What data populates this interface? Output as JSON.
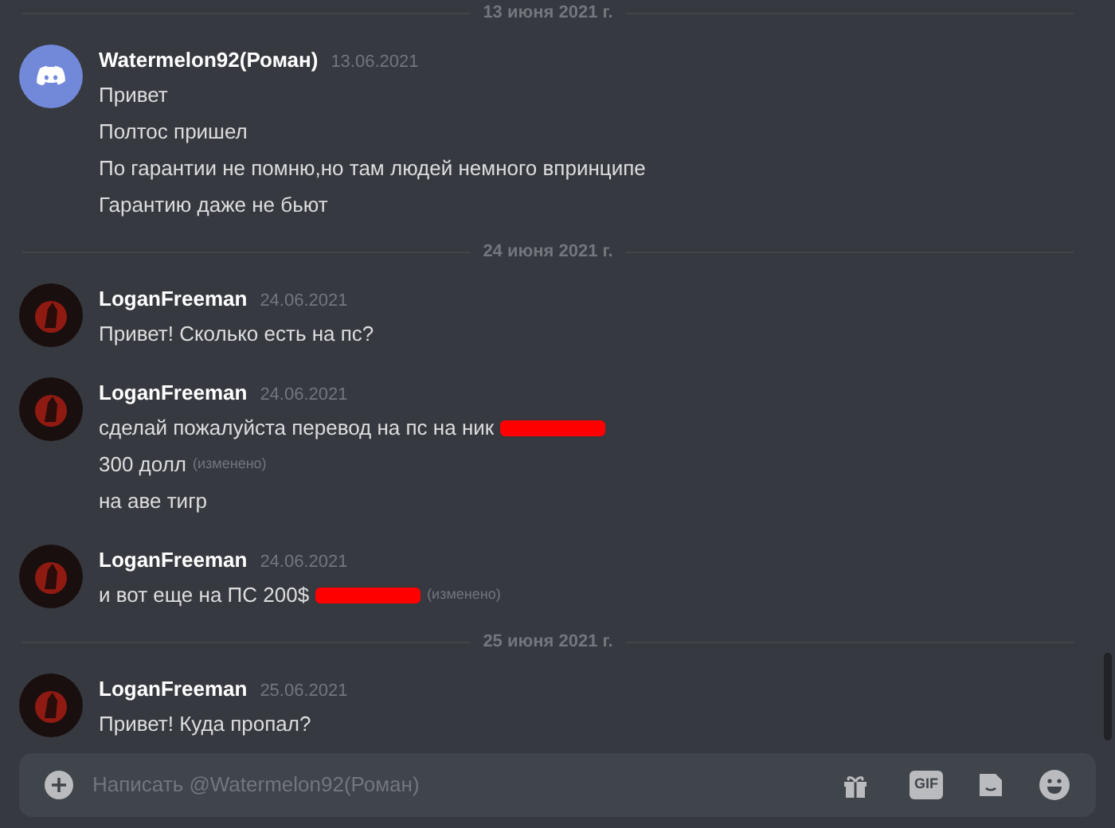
{
  "timeline": [
    {
      "kind": "divider",
      "label": "13 июня 2021 г."
    },
    {
      "kind": "group",
      "avatar": {
        "kind": "discord"
      },
      "author": "Watermelon92(Роман)",
      "date": "13.06.2021",
      "lines": [
        {
          "text": "Привет",
          "redacted": false
        },
        {
          "text": "Полтос пришел",
          "redacted": false
        },
        {
          "text": "По гарантии не помню,но там людей немного впринципе",
          "redacted": false
        },
        {
          "text": "Гарантию даже не бьют",
          "redacted": false
        }
      ]
    },
    {
      "kind": "divider",
      "label": "24 июня 2021 г."
    },
    {
      "kind": "group",
      "avatar": {
        "kind": "dark"
      },
      "author": "LoganFreeman",
      "date": "24.06.2021",
      "lines": [
        {
          "text": "Привет! Сколько есть на пс?",
          "redacted": false
        }
      ]
    },
    {
      "kind": "group",
      "avatar": {
        "kind": "dark"
      },
      "author": "LoganFreeman",
      "date": "24.06.2021",
      "lines": [
        {
          "text": "сделай пожалуйста перевод на пс на ник",
          "redacted": true
        },
        {
          "text": "300 долл",
          "edited_label": "(изменено)",
          "redacted": false
        },
        {
          "text": "на аве тигр",
          "redacted": false
        }
      ]
    },
    {
      "kind": "group",
      "avatar": {
        "kind": "dark"
      },
      "author": "LoganFreeman",
      "date": "24.06.2021",
      "lines": [
        {
          "text": "и вот еще на ПС 200$",
          "edited_label": "(изменено)",
          "redacted": true
        }
      ]
    },
    {
      "kind": "divider",
      "label": "25 июня 2021 г."
    },
    {
      "kind": "group",
      "avatar": {
        "kind": "dark"
      },
      "author": "LoganFreeman",
      "date": "25.06.2021",
      "lines": [
        {
          "text": "Привет! Куда пропал?",
          "redacted": false
        }
      ]
    }
  ],
  "composer": {
    "placeholder": "Написать @Watermelon92(Роман)",
    "gif_label": "GIF"
  }
}
